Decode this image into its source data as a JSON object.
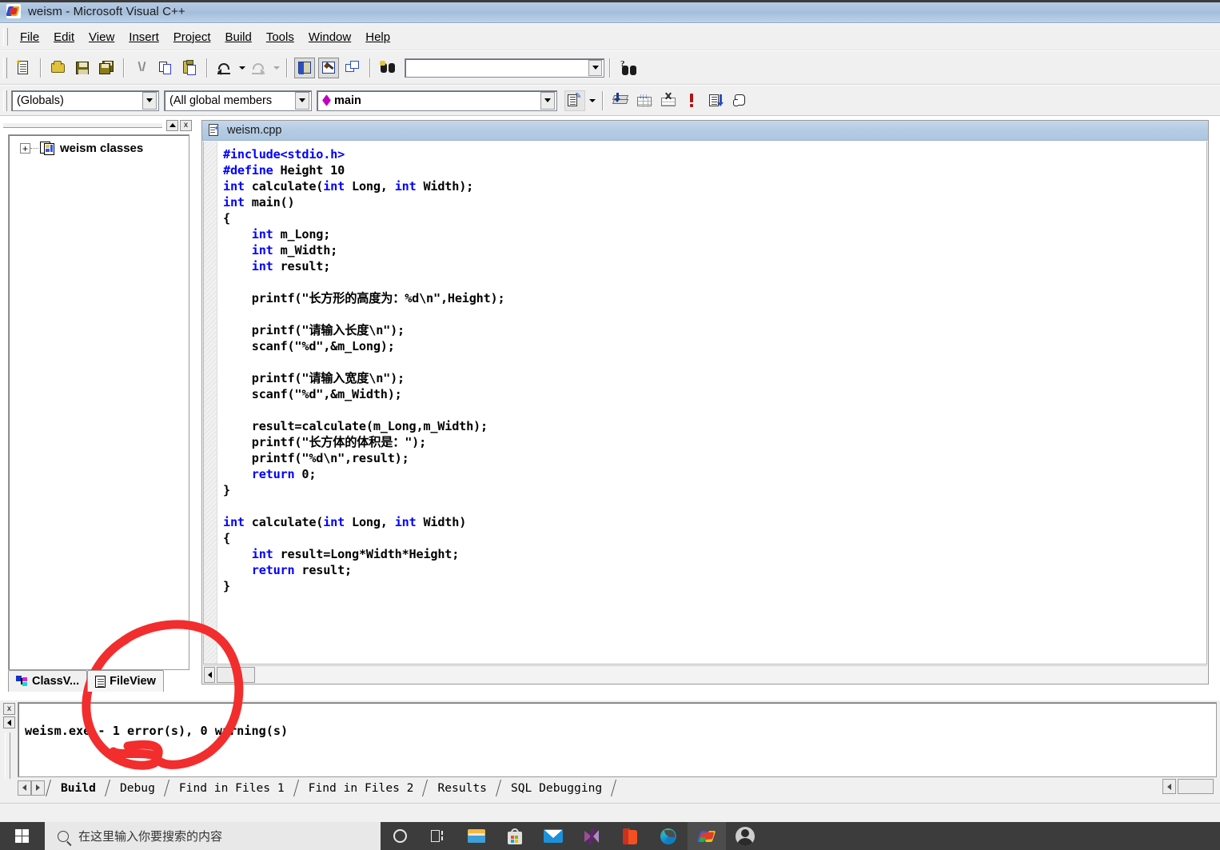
{
  "window": {
    "title": "weism - Microsoft Visual C++",
    "app_icon": "visual-cpp-icon"
  },
  "menu": {
    "items": [
      {
        "label": "File",
        "accel": "F"
      },
      {
        "label": "Edit",
        "accel": "E"
      },
      {
        "label": "View",
        "accel": "V"
      },
      {
        "label": "Insert",
        "accel": "I"
      },
      {
        "label": "Project",
        "accel": "P"
      },
      {
        "label": "Build",
        "accel": "B"
      },
      {
        "label": "Tools",
        "accel": "T"
      },
      {
        "label": "Window",
        "accel": "W"
      },
      {
        "label": "Help",
        "accel": "H"
      }
    ]
  },
  "standard_toolbar": {
    "buttons": [
      {
        "name": "new-text-file-icon"
      },
      {
        "name": "open-folder-icon"
      },
      {
        "name": "save-icon"
      },
      {
        "name": "save-all-icon"
      },
      {
        "name": "cut-icon"
      },
      {
        "name": "copy-icon"
      },
      {
        "name": "paste-icon"
      },
      {
        "name": "undo-icon"
      },
      {
        "name": "redo-icon"
      },
      {
        "name": "workspace-pane-icon"
      },
      {
        "name": "output-pane-icon"
      },
      {
        "name": "window-list-icon"
      },
      {
        "name": "find-in-files-icon"
      },
      {
        "name": "help-search-icon"
      }
    ],
    "find_box": {
      "value": "",
      "placeholder": ""
    }
  },
  "wizard_bar": {
    "class_combo": {
      "value": "(Globals)"
    },
    "members_combo": {
      "value": "(All global members"
    },
    "function_combo": {
      "value": "main",
      "icon": "member-diamond-icon"
    },
    "action_button": "wizardbar-action-icon"
  },
  "build_toolbar": {
    "buttons": [
      {
        "name": "compile-icon"
      },
      {
        "name": "build-icon"
      },
      {
        "name": "stop-build-icon"
      },
      {
        "name": "execute-program-icon"
      },
      {
        "name": "go-step-icon"
      },
      {
        "name": "insert-breakpoint-icon"
      }
    ]
  },
  "workspace": {
    "minimize_label": "",
    "close_label": "x",
    "tree": [
      {
        "label": "weism classes",
        "expander": "+",
        "icon": "class-folder-icon"
      }
    ],
    "tabs": [
      {
        "label": "ClassV...",
        "icon": "classview-icon",
        "active": false
      },
      {
        "label": "FileView",
        "icon": "fileview-icon",
        "active": true
      }
    ]
  },
  "editor": {
    "tab_title": "weism.cpp",
    "tab_icon": "source-file-icon",
    "lines": [
      [
        {
          "t": "#include<stdio.h>",
          "c": "pp"
        }
      ],
      [
        {
          "t": "#define",
          "c": "pp"
        },
        {
          "t": " Height 10",
          "c": ""
        }
      ],
      [
        {
          "t": "int",
          "c": "kw"
        },
        {
          "t": " calculate(",
          "c": ""
        },
        {
          "t": "int",
          "c": "kw"
        },
        {
          "t": " Long, ",
          "c": ""
        },
        {
          "t": "int",
          "c": "kw"
        },
        {
          "t": " Width);",
          "c": ""
        }
      ],
      [
        {
          "t": "int",
          "c": "kw"
        },
        {
          "t": " main()",
          "c": ""
        }
      ],
      [
        {
          "t": "{",
          "c": ""
        }
      ],
      [
        {
          "t": "    ",
          "c": ""
        },
        {
          "t": "int",
          "c": "kw"
        },
        {
          "t": " m_Long;",
          "c": ""
        }
      ],
      [
        {
          "t": "    ",
          "c": ""
        },
        {
          "t": "int",
          "c": "kw"
        },
        {
          "t": " m_Width;",
          "c": ""
        }
      ],
      [
        {
          "t": "    ",
          "c": ""
        },
        {
          "t": "int",
          "c": "kw"
        },
        {
          "t": " result;",
          "c": ""
        }
      ],
      [
        {
          "t": "",
          "c": ""
        }
      ],
      [
        {
          "t": "    printf(\"长方形的高度为：%d\\n\",Height);",
          "c": ""
        }
      ],
      [
        {
          "t": "",
          "c": ""
        }
      ],
      [
        {
          "t": "    printf(\"请输入长度\\n\");",
          "c": ""
        }
      ],
      [
        {
          "t": "    scanf(\"%d\",&m_Long);",
          "c": ""
        }
      ],
      [
        {
          "t": "",
          "c": ""
        }
      ],
      [
        {
          "t": "    printf(\"请输入宽度\\n\");",
          "c": ""
        }
      ],
      [
        {
          "t": "    scanf(\"%d\",&m_Width);",
          "c": ""
        }
      ],
      [
        {
          "t": "",
          "c": ""
        }
      ],
      [
        {
          "t": "    result=calculate(m_Long,m_Width);",
          "c": ""
        }
      ],
      [
        {
          "t": "    printf(\"长方体的体积是：\");",
          "c": ""
        }
      ],
      [
        {
          "t": "    printf(\"%d\\n\",result);",
          "c": ""
        }
      ],
      [
        {
          "t": "    ",
          "c": ""
        },
        {
          "t": "return",
          "c": "kw"
        },
        {
          "t": " 0;",
          "c": ""
        }
      ],
      [
        {
          "t": "}",
          "c": ""
        }
      ],
      [
        {
          "t": "",
          "c": ""
        }
      ],
      [
        {
          "t": "int",
          "c": "kw"
        },
        {
          "t": " calculate(",
          "c": ""
        },
        {
          "t": "int",
          "c": "kw"
        },
        {
          "t": " Long, ",
          "c": ""
        },
        {
          "t": "int",
          "c": "kw"
        },
        {
          "t": " Width)",
          "c": ""
        }
      ],
      [
        {
          "t": "{",
          "c": ""
        }
      ],
      [
        {
          "t": "    ",
          "c": ""
        },
        {
          "t": "int",
          "c": "kw"
        },
        {
          "t": " result=Long*Width*Height;",
          "c": ""
        }
      ],
      [
        {
          "t": "    ",
          "c": ""
        },
        {
          "t": "return",
          "c": "kw"
        },
        {
          "t": " result;",
          "c": ""
        }
      ],
      [
        {
          "t": "}",
          "c": ""
        }
      ]
    ]
  },
  "output": {
    "close_label": "x",
    "text": "weism.exe - 1 error(s), 0 warning(s)",
    "tabs": [
      {
        "label": "Build",
        "active": true
      },
      {
        "label": "Debug",
        "active": false
      },
      {
        "label": "Find in Files 1",
        "active": false
      },
      {
        "label": "Find in Files 2",
        "active": false
      },
      {
        "label": "Results",
        "active": false
      },
      {
        "label": "SQL Debugging",
        "active": false
      }
    ]
  },
  "annotation": {
    "color": "#f22d2d",
    "shape": "hand-drawn-circle"
  },
  "taskbar": {
    "start_label": "windows-start-icon",
    "search_placeholder": "在这里输入你要搜索的内容",
    "icons": [
      {
        "name": "cortana-icon"
      },
      {
        "name": "task-view-icon"
      },
      {
        "name": "file-explorer-icon"
      },
      {
        "name": "microsoft-store-icon"
      },
      {
        "name": "mail-icon"
      },
      {
        "name": "visual-studio-icon"
      },
      {
        "name": "office-icon"
      },
      {
        "name": "microsoft-edge-icon"
      },
      {
        "name": "visual-cpp-taskbar-icon"
      },
      {
        "name": "user-avatar-icon"
      }
    ]
  }
}
